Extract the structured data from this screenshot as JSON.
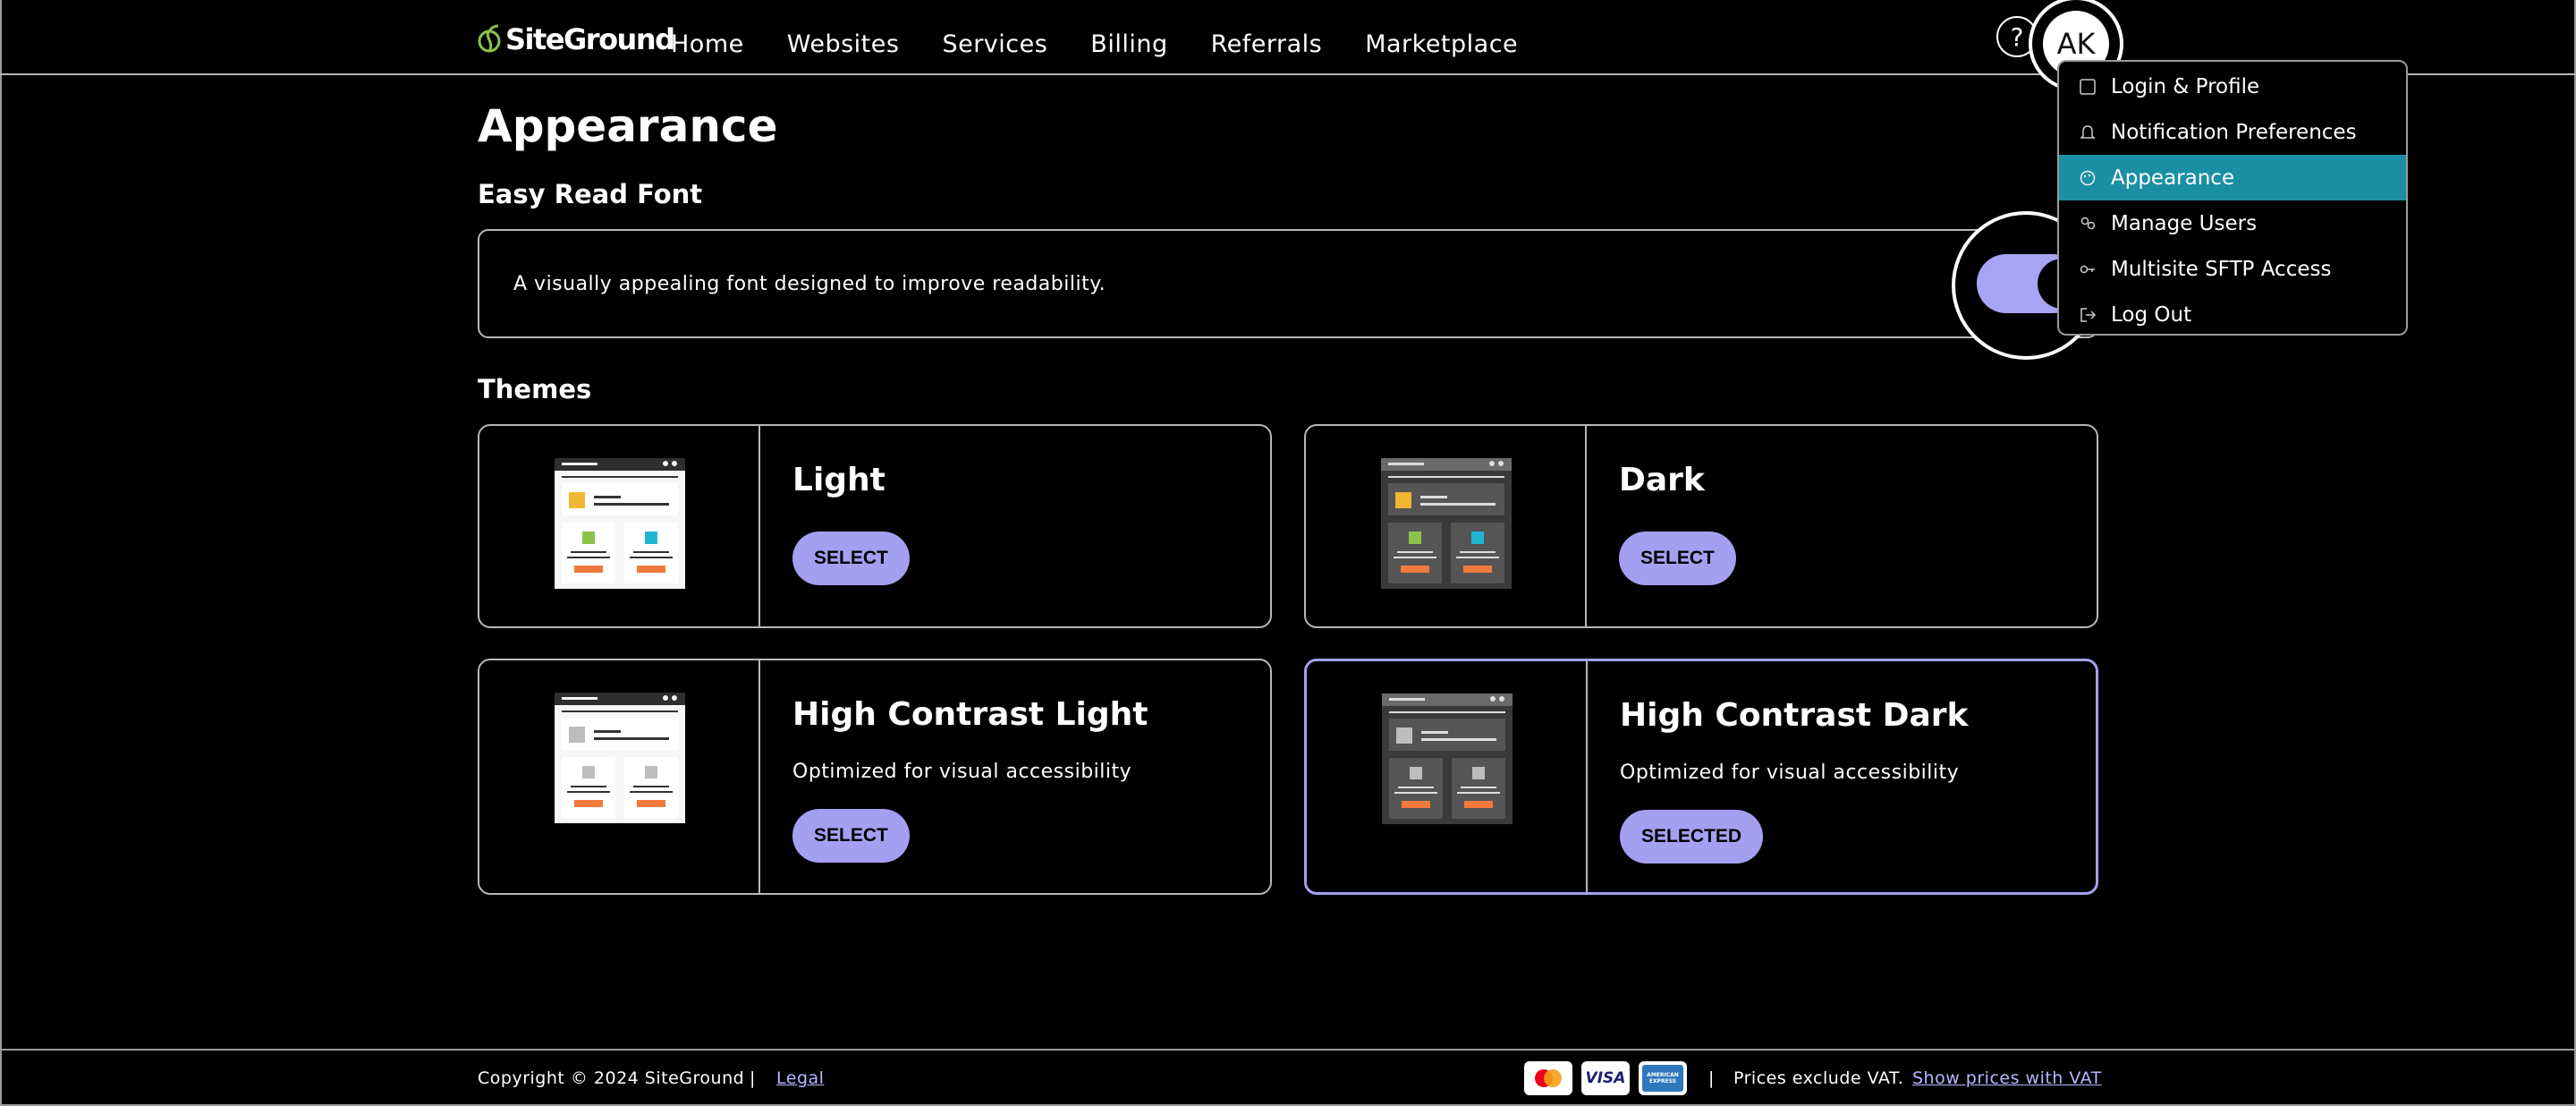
{
  "header": {
    "logo_text": "SiteGround",
    "nav": [
      "Home",
      "Websites",
      "Services",
      "Billing",
      "Referrals",
      "Marketplace"
    ],
    "help_label": "?",
    "avatar_initials": "AK"
  },
  "dropdown": {
    "items": [
      {
        "label": "Login & Profile",
        "icon": "user-icon"
      },
      {
        "label": "Notification Preferences",
        "icon": "bell-icon"
      },
      {
        "label": "Appearance",
        "icon": "palette-icon",
        "active": true
      },
      {
        "label": "Manage Users",
        "icon": "users-icon"
      },
      {
        "label": "Multisite SFTP Access",
        "icon": "key-icon"
      },
      {
        "label": "Log Out",
        "icon": "logout-icon"
      }
    ],
    "active_color": "#1a8fa4"
  },
  "page": {
    "title": "Appearance",
    "easy_read": {
      "title": "Easy Read Font",
      "description": "A visually appealing font designed to improve readability.",
      "enabled": true
    },
    "themes_title": "Themes",
    "themes": [
      {
        "name": "Light",
        "subtitle": "",
        "button": "SELECT",
        "selected": false
      },
      {
        "name": "Dark",
        "subtitle": "",
        "button": "SELECT",
        "selected": false
      },
      {
        "name": "High Contrast Light",
        "subtitle": "Optimized for visual accessibility",
        "button": "SELECT",
        "selected": false
      },
      {
        "name": "High Contrast Dark",
        "subtitle": "Optimized for visual accessibility",
        "button": "SELECTED",
        "selected": true
      }
    ]
  },
  "footer": {
    "copyright": "Copyright © 2024 SiteGround",
    "separator": "|",
    "legal": "Legal",
    "payment_icons": [
      "mastercard-icon",
      "visa-icon",
      "amex-icon"
    ],
    "visa_text": "VISA",
    "amex_text": "AMERICAN EXPRESS",
    "vat_note": "Prices exclude VAT.",
    "vat_link": "Show prices with VAT"
  },
  "colors": {
    "accent": "#a3a0f2",
    "link": "#b9b6ff",
    "thumb_orange": "#f07a3c",
    "thumb_yellow": "#f2b632",
    "thumb_green": "#8bc34a",
    "thumb_cyan": "#1fb6d6"
  }
}
